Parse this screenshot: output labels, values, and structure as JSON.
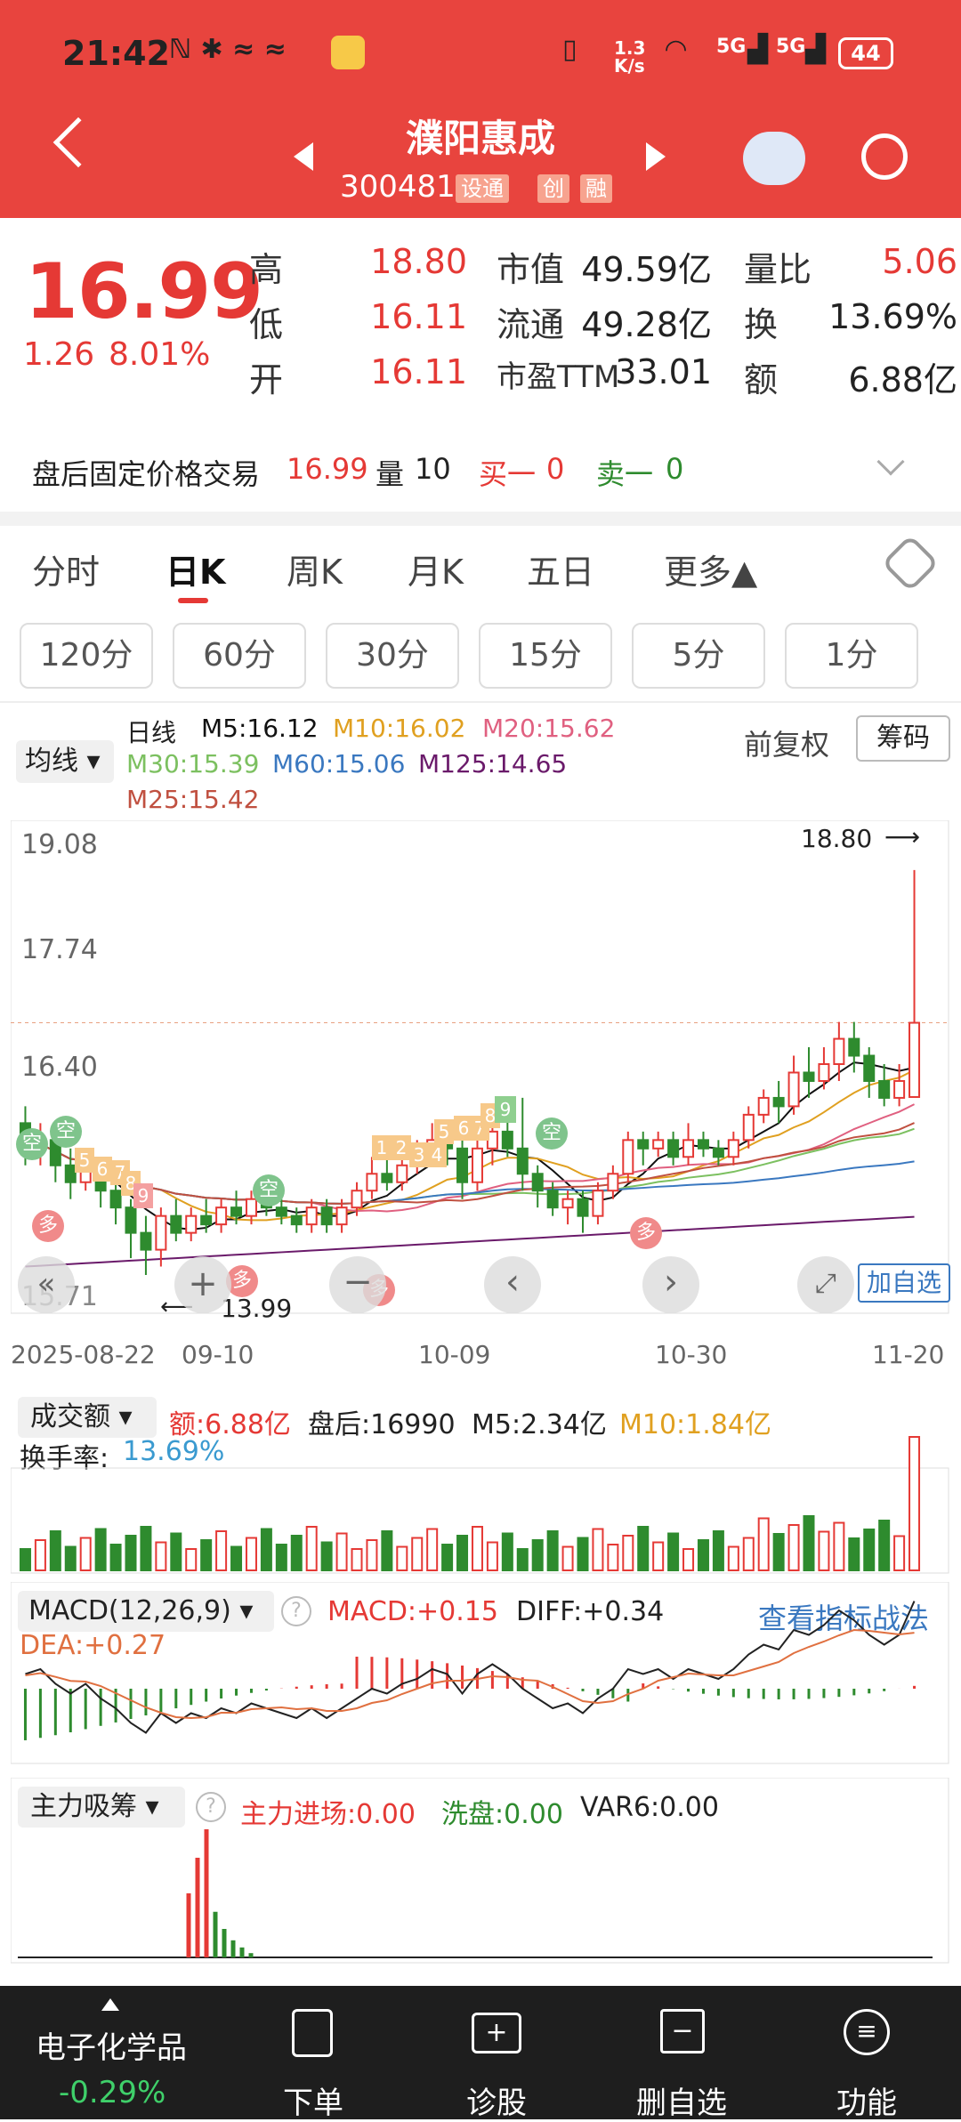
{
  "status_bar": {
    "time": "21:42",
    "net_speed": "1.3\nK/s",
    "battery": "44",
    "signal1": "5G",
    "signal2": "5G"
  },
  "header": {
    "title": "濮阳惠成",
    "code": "300481",
    "tags": [
      "设通",
      "创",
      "融"
    ]
  },
  "quote": {
    "price": "16.99",
    "change": "1.26",
    "change_pct": "8.01%",
    "high_label": "高",
    "high": "18.80",
    "low_label": "低",
    "low": "16.11",
    "open_label": "开",
    "open": "16.11",
    "mcap_label": "市值",
    "mcap": "49.59亿",
    "float_label": "流通",
    "float": "49.28亿",
    "pe_label": "市盈TTM",
    "pe": "33.01",
    "vr_label": "量比",
    "vr": "5.06",
    "turn_label": "换",
    "turn": "13.69%",
    "amt_label": "额",
    "amt": "6.88亿"
  },
  "after_hours": {
    "label": "盘后固定价格交易",
    "price": "16.99",
    "vol_label": "量",
    "vol": "10",
    "buy1_label": "买一",
    "buy1": "0",
    "sell1_label": "卖一",
    "sell1": "0"
  },
  "tabs": [
    "分时",
    "日K",
    "周K",
    "月K",
    "五日",
    "更多▲"
  ],
  "active_tab": "日K",
  "periods": [
    "120分",
    "60分",
    "30分",
    "15分",
    "5分",
    "1分"
  ],
  "ma": {
    "selector": "均线",
    "daily": "日线",
    "m5": "M5:16.12",
    "m10": "M10:16.02",
    "m20": "M20:15.62",
    "m30": "M30:15.39",
    "m60": "M60:15.06",
    "m125": "M125:14.65",
    "m25": "M25:15.42",
    "adjust": "前复权",
    "chips": "筹码"
  },
  "colors": {
    "brand": "#e8443e",
    "up": "#e53935",
    "down": "#2e8b2e",
    "m5": "#111111",
    "m10": "#e0a020",
    "m20": "#e06080",
    "m30": "#7cc060",
    "m60": "#3a78c0",
    "m125": "#6a1a6a",
    "m25": "#c05040"
  },
  "chart_data": {
    "type": "candlestick",
    "y_ticks": [
      "19.08",
      "17.74",
      "16.40",
      "15.71"
    ],
    "x_ticks": [
      "2025-08-22",
      "09-10",
      "10-09",
      "10-30",
      "11-20"
    ],
    "high_mark": "18.80",
    "low_mark": "13.99",
    "candles": [
      {
        "o": 15.8,
        "c": 15.5,
        "h": 16.0,
        "l": 15.3
      },
      {
        "o": 15.5,
        "c": 15.6,
        "h": 15.8,
        "l": 15.3
      },
      {
        "o": 15.6,
        "c": 15.3,
        "h": 15.7,
        "l": 15.1
      },
      {
        "o": 15.3,
        "c": 15.1,
        "h": 15.5,
        "l": 14.9
      },
      {
        "o": 15.1,
        "c": 15.3,
        "h": 15.4,
        "l": 15.0
      },
      {
        "o": 15.3,
        "c": 15.0,
        "h": 15.4,
        "l": 14.8
      },
      {
        "o": 15.0,
        "c": 14.8,
        "h": 15.1,
        "l": 14.6
      },
      {
        "o": 14.8,
        "c": 14.5,
        "h": 14.9,
        "l": 14.2
      },
      {
        "o": 14.5,
        "c": 14.3,
        "h": 14.7,
        "l": 14.0
      },
      {
        "o": 14.3,
        "c": 14.7,
        "h": 14.8,
        "l": 14.1
      },
      {
        "o": 14.7,
        "c": 14.5,
        "h": 14.9,
        "l": 14.4
      },
      {
        "o": 14.5,
        "c": 14.7,
        "h": 14.8,
        "l": 14.4
      },
      {
        "o": 14.7,
        "c": 14.6,
        "h": 14.9,
        "l": 14.5
      },
      {
        "o": 14.6,
        "c": 14.8,
        "h": 14.9,
        "l": 14.5
      },
      {
        "o": 14.8,
        "c": 14.7,
        "h": 15.0,
        "l": 14.6
      },
      {
        "o": 14.7,
        "c": 14.9,
        "h": 15.0,
        "l": 14.6
      },
      {
        "o": 14.9,
        "c": 14.8,
        "h": 15.0,
        "l": 14.7
      },
      {
        "o": 14.8,
        "c": 14.7,
        "h": 14.9,
        "l": 14.6
      },
      {
        "o": 14.7,
        "c": 14.6,
        "h": 14.8,
        "l": 14.5
      },
      {
        "o": 14.6,
        "c": 14.8,
        "h": 14.9,
        "l": 14.5
      },
      {
        "o": 14.8,
        "c": 14.6,
        "h": 14.9,
        "l": 14.5
      },
      {
        "o": 14.6,
        "c": 14.8,
        "h": 14.9,
        "l": 14.5
      },
      {
        "o": 14.8,
        "c": 15.0,
        "h": 15.1,
        "l": 14.7
      },
      {
        "o": 15.0,
        "c": 15.2,
        "h": 15.4,
        "l": 14.9
      },
      {
        "o": 15.2,
        "c": 15.1,
        "h": 15.4,
        "l": 15.0
      },
      {
        "o": 15.1,
        "c": 15.3,
        "h": 15.5,
        "l": 15.0
      },
      {
        "o": 15.3,
        "c": 15.4,
        "h": 15.6,
        "l": 15.2
      },
      {
        "o": 15.4,
        "c": 15.6,
        "h": 15.8,
        "l": 15.3
      },
      {
        "o": 15.6,
        "c": 15.5,
        "h": 15.7,
        "l": 15.3
      },
      {
        "o": 15.5,
        "c": 15.1,
        "h": 15.6,
        "l": 14.9
      },
      {
        "o": 15.1,
        "c": 15.5,
        "h": 15.7,
        "l": 15.0
      },
      {
        "o": 15.5,
        "c": 15.7,
        "h": 16.0,
        "l": 15.3
      },
      {
        "o": 15.7,
        "c": 15.5,
        "h": 15.9,
        "l": 15.4
      },
      {
        "o": 15.5,
        "c": 15.2,
        "h": 16.1,
        "l": 15.0
      },
      {
        "o": 15.2,
        "c": 15.0,
        "h": 15.3,
        "l": 14.8
      },
      {
        "o": 15.0,
        "c": 14.8,
        "h": 15.1,
        "l": 14.7
      },
      {
        "o": 14.8,
        "c": 14.9,
        "h": 15.0,
        "l": 14.6
      },
      {
        "o": 14.9,
        "c": 14.7,
        "h": 15.0,
        "l": 14.5
      },
      {
        "o": 14.7,
        "c": 15.0,
        "h": 15.1,
        "l": 14.6
      },
      {
        "o": 15.0,
        "c": 15.2,
        "h": 15.3,
        "l": 14.9
      },
      {
        "o": 15.2,
        "c": 15.6,
        "h": 15.7,
        "l": 15.1
      },
      {
        "o": 15.6,
        "c": 15.5,
        "h": 15.7,
        "l": 15.3
      },
      {
        "o": 15.5,
        "c": 15.6,
        "h": 15.7,
        "l": 15.4
      },
      {
        "o": 15.6,
        "c": 15.4,
        "h": 15.7,
        "l": 15.3
      },
      {
        "o": 15.4,
        "c": 15.6,
        "h": 15.8,
        "l": 15.3
      },
      {
        "o": 15.6,
        "c": 15.5,
        "h": 15.7,
        "l": 15.4
      },
      {
        "o": 15.5,
        "c": 15.4,
        "h": 15.6,
        "l": 15.3
      },
      {
        "o": 15.4,
        "c": 15.6,
        "h": 15.7,
        "l": 15.3
      },
      {
        "o": 15.6,
        "c": 15.9,
        "h": 16.0,
        "l": 15.5
      },
      {
        "o": 15.9,
        "c": 16.1,
        "h": 16.2,
        "l": 15.8
      },
      {
        "o": 16.1,
        "c": 16.0,
        "h": 16.3,
        "l": 15.8
      },
      {
        "o": 16.0,
        "c": 16.4,
        "h": 16.6,
        "l": 15.9
      },
      {
        "o": 16.4,
        "c": 16.3,
        "h": 16.7,
        "l": 16.1
      },
      {
        "o": 16.3,
        "c": 16.5,
        "h": 16.7,
        "l": 16.2
      },
      {
        "o": 16.5,
        "c": 16.8,
        "h": 17.0,
        "l": 16.3
      },
      {
        "o": 16.8,
        "c": 16.6,
        "h": 17.0,
        "l": 16.4
      },
      {
        "o": 16.6,
        "c": 16.3,
        "h": 16.7,
        "l": 16.1
      },
      {
        "o": 16.3,
        "c": 16.1,
        "h": 16.5,
        "l": 16.0
      },
      {
        "o": 16.1,
        "c": 16.3,
        "h": 16.5,
        "l": 16.0
      },
      {
        "o": 16.11,
        "c": 16.99,
        "h": 18.8,
        "l": 16.11
      }
    ],
    "volume_label": "成交额",
    "volume_stats": {
      "amt": "额:6.88亿",
      "after": "盘后:16990",
      "m5": "M5:2.34亿",
      "m10": "M10:1.84亿",
      "turn_label": "换手率:",
      "turn": "13.69%"
    },
    "macd": {
      "label": "MACD(12,26,9)",
      "macd": "MACD:+0.15",
      "diff": "DIFF:+0.34",
      "dea": "DEA:+0.27",
      "link": "查看指标战法"
    },
    "fund": {
      "label": "主力吸筹",
      "main": "主力进场:0.00",
      "wash": "洗盘:0.00",
      "var6": "VAR6:0.00"
    }
  },
  "chart_overlay": {
    "add_watch": "加自选",
    "signal_labels": [
      "空",
      "空",
      "空",
      "空",
      "多",
      "多",
      "多",
      "多"
    ],
    "num_labels": [
      "5",
      "6",
      "7",
      "8",
      "9",
      "1",
      "2",
      "3",
      "4",
      "5",
      "6",
      "7",
      "8",
      "9"
    ]
  },
  "bottom_bar": {
    "sector": "电子化学品",
    "sector_chg": "-0.29%",
    "items": [
      "下单",
      "诊股",
      "删自选",
      "功能"
    ]
  }
}
